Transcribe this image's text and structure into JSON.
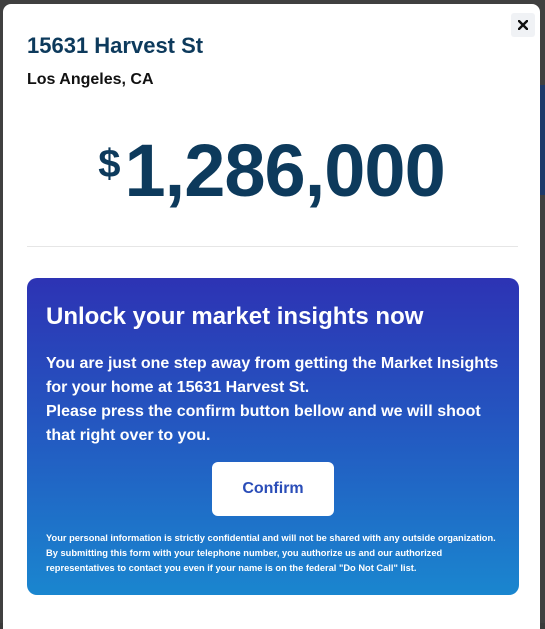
{
  "listing": {
    "address": "15631 Harvest St",
    "city": "Los Angeles, CA",
    "price_currency": "$",
    "price_value": "1,286,000"
  },
  "modal": {
    "close_label": "×"
  },
  "insights_card": {
    "title": "Unlock your market insights now",
    "body_line1": "You are just one step away from getting the Market Insights for your home at 15631 Harvest St.",
    "body_line2": "Please press the confirm button bellow and we will shoot that right over to you.",
    "confirm_label": "Confirm",
    "disclaimer": "Your personal information is strictly confidential and will not be shared with any outside organization. By submitting this form with your telephone number, you authorize us and our authorized representatives to contact you even if your name is on the federal \"Do Not Call\" list."
  },
  "colors": {
    "heading": "#0d3a5c",
    "card_gradient_top": "#2d33b4",
    "card_gradient_bottom": "#1a86cf",
    "button_text": "#2a4db8"
  },
  "icons": {
    "close": "close-icon"
  }
}
